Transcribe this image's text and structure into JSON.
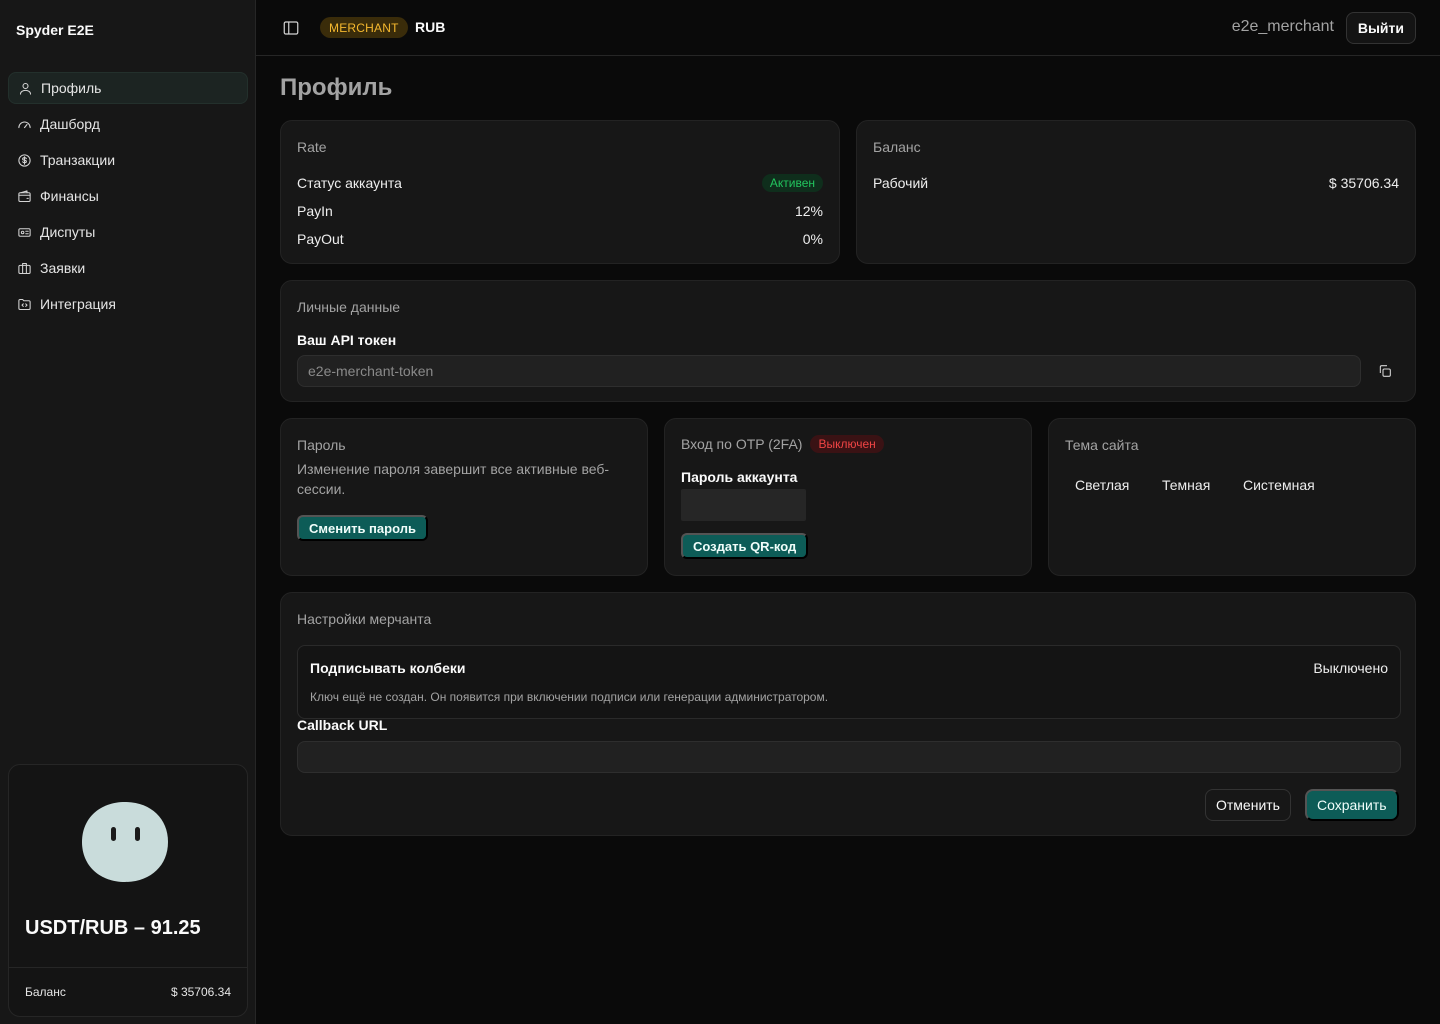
{
  "app": {
    "brand": "Spyder E2E"
  },
  "sidebar": {
    "items": [
      {
        "label": "Профиль",
        "icon": "user-icon",
        "active": true
      },
      {
        "label": "Дашборд",
        "icon": "gauge-icon"
      },
      {
        "label": "Транзакции",
        "icon": "dollar-circle-icon"
      },
      {
        "label": "Финансы",
        "icon": "wallet-icon"
      },
      {
        "label": "Диспуты",
        "icon": "ticket-icon"
      },
      {
        "label": "Заявки",
        "icon": "briefcase-icon"
      },
      {
        "label": "Интеграция",
        "icon": "folder-code-icon"
      }
    ],
    "rate_card": {
      "rate": "USDT/RUB – 91.25",
      "balance_label": "Баланс",
      "balance_value": "$ 35706.34"
    }
  },
  "header": {
    "role": "MERCHANT",
    "currency": "RUB",
    "username": "e2e_merchant",
    "logout_label": "Выйти"
  },
  "page": {
    "title": "Профиль"
  },
  "rate_section": {
    "title": "Rate",
    "status_label": "Статус аккаунта",
    "status_value": "Активен",
    "payin_label": "PayIn",
    "payin_value": "12%",
    "payout_label": "PayOut",
    "payout_value": "0%"
  },
  "balance_section": {
    "title": "Баланс",
    "working_label": "Рабочий",
    "working_value": "$ 35706.34"
  },
  "personal": {
    "title": "Личные данные",
    "token_label": "Ваш API токен",
    "token_value": "e2e-merchant-token"
  },
  "password": {
    "title": "Пароль",
    "description": "Изменение пароля завершит все активные веб-сессии.",
    "change_label": "Сменить пароль"
  },
  "otp": {
    "title": "Вход по OTP (2FA)",
    "status": "Выключен",
    "password_label": "Пароль аккаунта",
    "password_value": "",
    "qr_label": "Создать QR-код"
  },
  "theme": {
    "title": "Тема сайта",
    "options": [
      "Светлая",
      "Темная",
      "Системная"
    ]
  },
  "merchant": {
    "title": "Настройки мерчанта",
    "sign_label": "Подписывать колбеки",
    "sign_status": "Выключено",
    "sign_hint": "Ключ ещё не создан. Он появится при включении подписи или генерации администратором.",
    "callback_label": "Callback URL",
    "callback_value": "",
    "cancel_label": "Отменить",
    "save_label": "Сохранить"
  },
  "colors": {
    "accent": "#0d5c57",
    "success": "#22c55e",
    "danger": "#ef4444",
    "role_badge": "#f5b82e"
  }
}
